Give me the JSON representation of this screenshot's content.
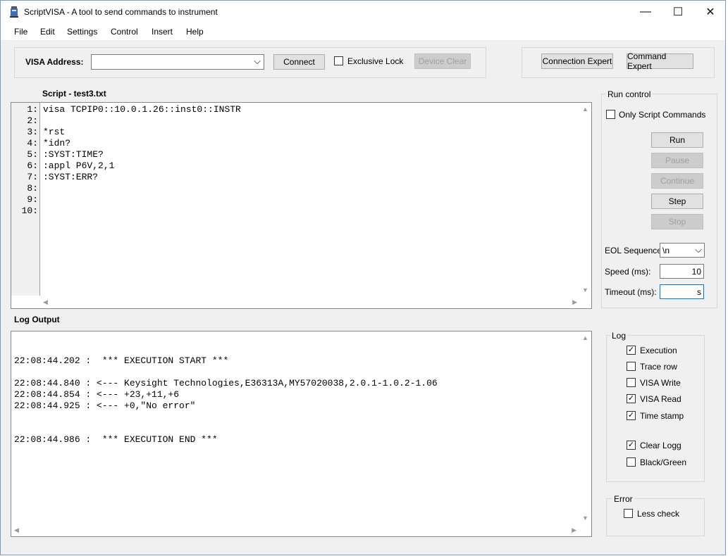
{
  "window": {
    "title": "ScriptVISA - A tool to send commands to instrument",
    "minimize": "—",
    "maximize": "☐",
    "close": "✕"
  },
  "menu": [
    "File",
    "Edit",
    "Settings",
    "Control",
    "Insert",
    "Help"
  ],
  "visa": {
    "address_label": "VISA Address:",
    "address_value": "",
    "connect_label": "Connect",
    "exclusive_lock_label": "Exclusive Lock",
    "exclusive_lock_checked": false,
    "device_clear_label": "Device Clear"
  },
  "experts": {
    "connection_label": "Connection Expert",
    "command_label": "Command Expert"
  },
  "script": {
    "title": "Script - test3.txt",
    "line_numbers": [
      "1:",
      "2:",
      "3:",
      "4:",
      "5:",
      "6:",
      "7:",
      "8:",
      "9:",
      "10:"
    ],
    "lines": [
      "visa TCPIP0::10.0.1.26::inst0::INSTR",
      "",
      "*rst",
      "*idn?",
      ":SYST:TIME?",
      ":appl P6V,2,1",
      ":SYST:ERR?",
      "",
      "",
      ""
    ]
  },
  "run_control": {
    "title": "Run control",
    "only_script_label": "Only Script Commands",
    "only_script_checked": false,
    "run_label": "Run",
    "pause_label": "Pause",
    "continue_label": "Continue",
    "step_label": "Step",
    "stop_label": "Stop",
    "eol_label": "EOL Sequence:",
    "eol_value": "\\n",
    "speed_label": "Speed (ms):",
    "speed_value": "10",
    "timeout_label": "Timeout (ms):",
    "timeout_value": "s"
  },
  "log": {
    "title": "Log Output",
    "lines": [
      "",
      "22:08:44.202 :  *** EXECUTION START ***",
      "",
      "22:08:44.840 : <--- Keysight Technologies,E36313A,MY57020038,2.0.1-1.0.2-1.06",
      "22:08:44.854 : <--- +23,+11,+6",
      "22:08:44.925 : <--- +0,\"No error\"",
      "",
      "",
      "22:08:44.986 :  *** EXECUTION END ***"
    ]
  },
  "log_options": {
    "title": "Log",
    "items": [
      {
        "label": "Execution",
        "checked": true
      },
      {
        "label": "Trace row",
        "checked": false
      },
      {
        "label": "VISA Write",
        "checked": false
      },
      {
        "label": "VISA Read",
        "checked": true
      },
      {
        "label": "Time stamp",
        "checked": true
      },
      {
        "label": "Clear Logg",
        "checked": true
      },
      {
        "label": "Black/Green",
        "checked": false
      }
    ]
  },
  "error": {
    "title": "Error",
    "less_check_label": "Less check",
    "less_check_checked": false
  },
  "icons": {
    "check": "✓",
    "dropdown": "⌵",
    "scroll_up": "▲",
    "scroll_down": "▼",
    "scroll_left": "◀",
    "scroll_right": "▶"
  },
  "colors": {
    "window_border": "#7a9cc9",
    "panel": "#f0f0f0",
    "focus_border": "#0078d7"
  }
}
